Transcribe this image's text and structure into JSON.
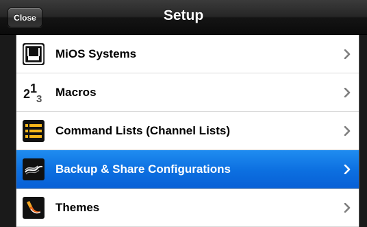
{
  "header": {
    "title": "Setup",
    "close_label": "Close"
  },
  "rows": [
    {
      "label": "MiOS Systems",
      "icon": "router-icon",
      "selected": false
    },
    {
      "label": "Macros",
      "icon": "macro-numbers-icon",
      "selected": false
    },
    {
      "label": "Command Lists (Channel Lists)",
      "icon": "list-icon",
      "selected": false
    },
    {
      "label": "Backup & Share Configurations",
      "icon": "backup-share-icon",
      "selected": true
    },
    {
      "label": "Themes",
      "icon": "paintbrush-icon",
      "selected": false
    }
  ],
  "colors": {
    "selected_row": "#0c6fe0",
    "navbar": "#1c1c1c",
    "chevron": "#7f7f7f",
    "chevron_selected": "#ffffff",
    "list_icon_accent": "#f5b61a"
  }
}
